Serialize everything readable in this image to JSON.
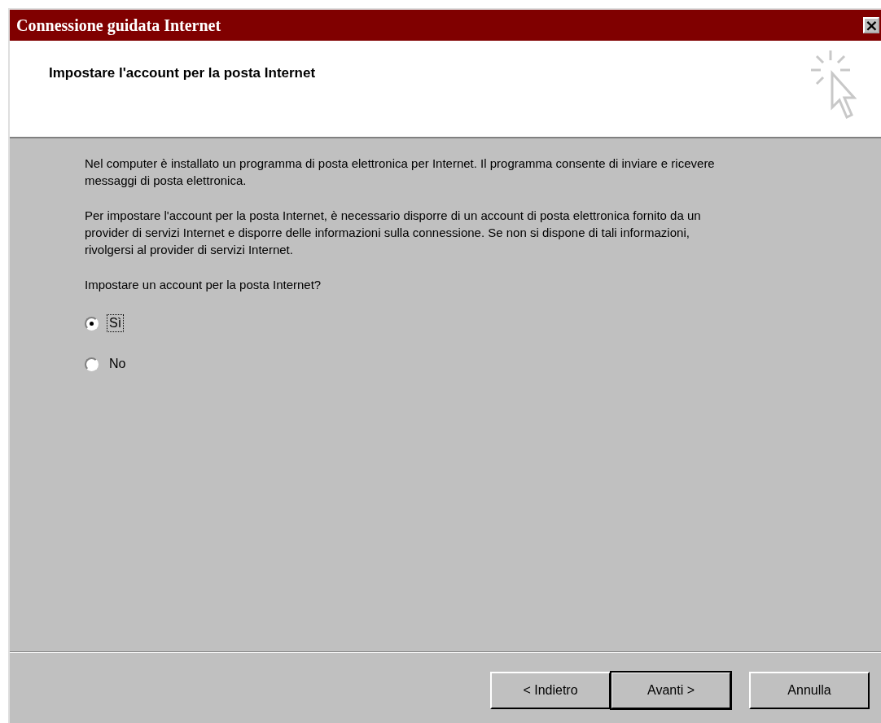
{
  "window": {
    "title": "Connessione guidata Internet",
    "close": "×"
  },
  "header": {
    "title": "Impostare l'account per la posta Internet"
  },
  "paragraphs": [
    "Nel computer è installato un programma di posta elettronica per Internet. Il programma consente di inviare e ricevere messaggi di posta elettronica.",
    "Per impostare l'account per la posta Internet, è necessario disporre di un account di posta elettronica fornito da un provider di servizi Internet e disporre delle informazioni sulla connessione. Se non si dispone di tali informazioni, rivolgersi al provider di servizi Internet."
  ],
  "question": "Impostare un account per la posta Internet?",
  "options": [
    {
      "label": "Sì",
      "selected": true,
      "focused": true
    },
    {
      "label": "No",
      "selected": false,
      "focused": false
    }
  ],
  "buttons": [
    {
      "label": "< Indietro",
      "default": false
    },
    {
      "label": "Avanti >",
      "default": true
    },
    {
      "label": "Annulla",
      "default": false
    }
  ]
}
